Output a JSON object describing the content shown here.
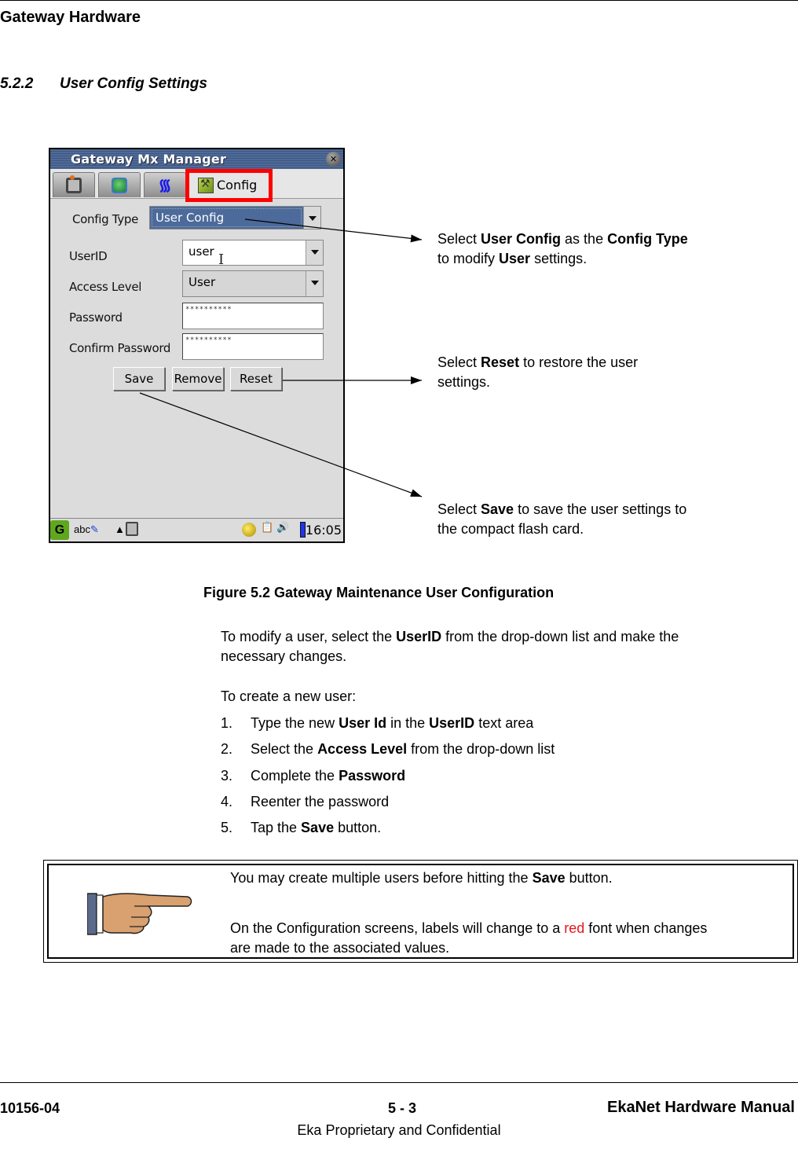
{
  "header": {
    "title": "Gateway Hardware"
  },
  "section": {
    "number": "5.2.2",
    "title": "User Config Settings"
  },
  "device": {
    "window_title": "Gateway Mx Manager",
    "tabs": [
      {
        "icon": "home-network-icon",
        "label": ""
      },
      {
        "icon": "globe-icon",
        "label": ""
      },
      {
        "icon": "wireless-icon",
        "label": ""
      },
      {
        "icon": "config-icon",
        "label": "Config",
        "active": true
      }
    ],
    "form": {
      "config_type_label": "Config Type",
      "config_type_value": "User Config",
      "userid_label": "UserID",
      "userid_value": "user",
      "access_level_label": "Access Level",
      "access_level_value": "User",
      "password_label": "Password",
      "password_value": "**********",
      "confirm_password_label": "Confirm Password",
      "confirm_password_value": "**********"
    },
    "buttons": {
      "save": "Save",
      "remove": "Remove",
      "reset": "Reset"
    },
    "taskbar": {
      "start": "G",
      "input": "abc",
      "clock": "16:05"
    },
    "highlight_color": "#ff0000"
  },
  "callouts": {
    "config_type": {
      "pre": "Select ",
      "b1": "User Config",
      "mid": " as the ",
      "b2": "Config Type",
      "line2_pre": "to modify ",
      "b3": "User",
      "line2_post": " settings."
    },
    "reset": {
      "pre": "Select ",
      "b1": "Reset",
      "post": " to restore the user",
      "line2": "settings."
    },
    "save": {
      "pre": "Select ",
      "b1": "Save",
      "post": " to save the user settings to",
      "line2": "the compact flash card."
    }
  },
  "figure": {
    "caption": "Figure 5.2  Gateway Maintenance User Configuration"
  },
  "body": {
    "para1_pre": "To modify a user, select the ",
    "para1_bold": "UserID",
    "para1_post": " from the drop-down list and make the",
    "para1_line2": "necessary changes.",
    "para2": "To create a new user:",
    "steps": [
      {
        "n": "1.",
        "pre": "Type the new ",
        "b1": "User Id",
        "mid": " in the ",
        "b2": "UserID",
        "post": " text area"
      },
      {
        "n": "2.",
        "pre": "Select the ",
        "b1": "Access Level",
        "post": " from the drop-down list"
      },
      {
        "n": "3.",
        "pre": "Complete the ",
        "b1": "Password",
        "post": ""
      },
      {
        "n": "4.",
        "pre": "Reenter the password",
        "b1": "",
        "post": ""
      },
      {
        "n": "5.",
        "pre": "Tap the ",
        "b1": "Save",
        "post": " button."
      }
    ]
  },
  "note": {
    "line1_pre": "You may create multiple users before hitting the ",
    "line1_bold": "Save",
    "line1_post": " button.",
    "line2_pre": "On the Configuration screens, labels will change to a ",
    "line2_red": "red",
    "line2_post": " font when changes",
    "line3": "are made to the associated values.",
    "red_color": "#e8141c"
  },
  "footer": {
    "doc_number": "10156-04",
    "page": "5 - 3",
    "manual_title": "EkaNet Hardware Manual",
    "confidential": "Eka Proprietary and Confidential"
  }
}
